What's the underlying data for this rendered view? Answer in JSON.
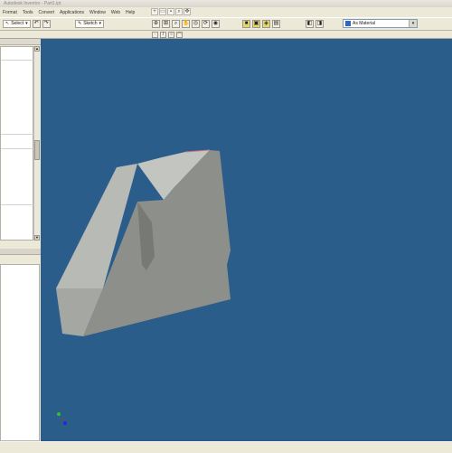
{
  "window": {
    "title": "Autodesk Inventor - Part1.ipt"
  },
  "menu": {
    "items": [
      "Format",
      "Tools",
      "Convert",
      "Applications",
      "Window",
      "Web",
      "Help"
    ]
  },
  "toolbar": {
    "select_label": "Select",
    "sketch_label": "Sketch",
    "material_value": "As Material"
  },
  "colors": {
    "canvas_background": "#2a5d8a",
    "part_face_light": "#b9bbb6",
    "part_face_dark": "#8c8e89",
    "chrome": "#ece9d8"
  },
  "icons": [
    "new-icon",
    "open-icon",
    "save-icon",
    "undo-icon",
    "redo-icon",
    "select-icon",
    "zoom-icon",
    "pan-icon",
    "rotate-icon",
    "look-at-icon",
    "shaded-display-icon",
    "shadow-icon",
    "camera-icon"
  ]
}
